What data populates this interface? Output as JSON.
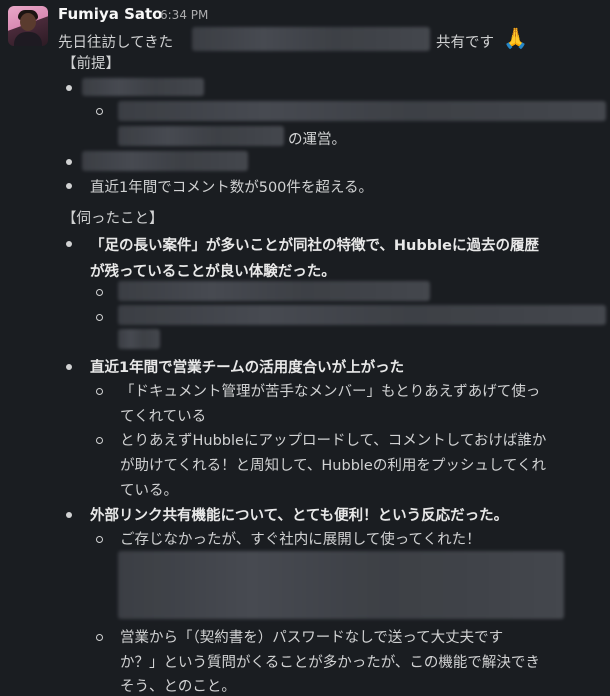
{
  "message": {
    "author": "Fumiya Sato",
    "time": "6:34 PM",
    "intro_before": "先日往訪してきた",
    "intro_after": "共有です",
    "emoji": "🙏",
    "section_premise": "【前提】",
    "premise_operation_suffix": "の運営。",
    "premise_comments": "直近1年間でコメント数が500件を超える。",
    "section_heard": "【伺ったこと】",
    "point1_line1": "「足の長い案件」が多いことが同社の特徴で、Hubbleに過去の履歴",
    "point1_line2": "が残っていることが良い体験だった。",
    "point2": "直近1年間で営業チームの活用度合いが上がった",
    "point2_sub1_line1": "「ドキュメント管理が苦手なメンバー」もとりあえずあげて使っ",
    "point2_sub1_line2": "てくれている",
    "point2_sub2_line1": "とりあえずHubbleにアップロードして、コメントしておけば誰か",
    "point2_sub2_line2": "が助けてくれる！と周知して、Hubbleの利用をプッシュしてくれ",
    "point2_sub2_line3": "ている。",
    "point3": "外部リンク共有機能について、とても便利！という反応だった。",
    "point3_sub1": "ご存じなかったが、すぐ社内に展開して使ってくれた！",
    "point3_sub2_line1": "営業から「（契約書を）パスワードなしで送って大丈夫です",
    "point3_sub2_line2": "か？」という質問がくることが多かったが、この機能で解決でき",
    "point3_sub2_line3": "そう、とのこと。"
  }
}
